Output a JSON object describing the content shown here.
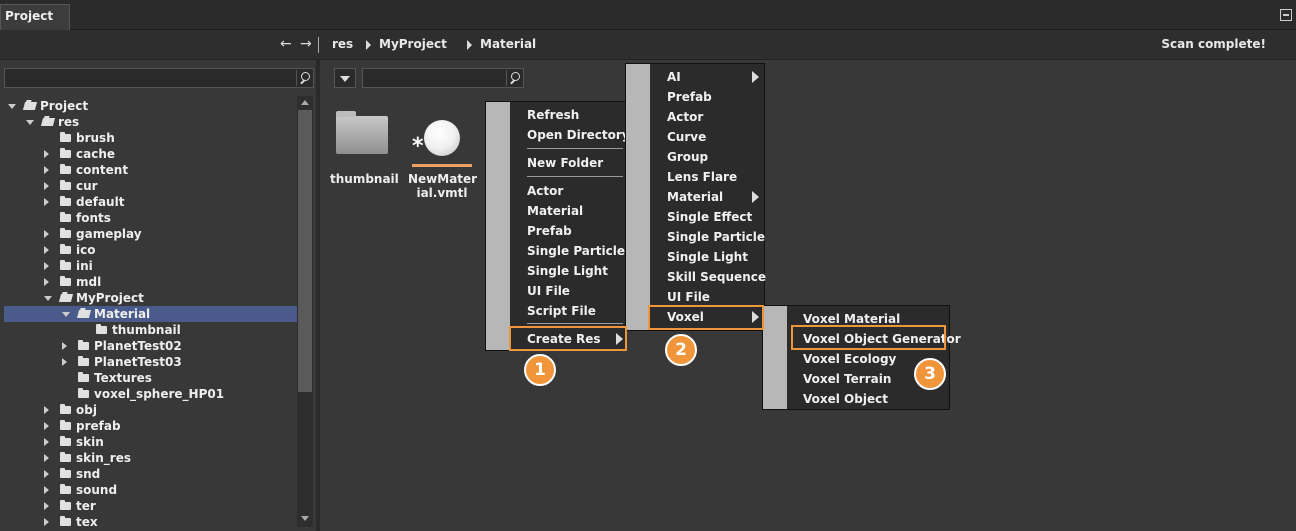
{
  "window": {
    "tab_title": "Project"
  },
  "nav": {
    "back_icon": "arrow-left-icon",
    "forward_icon": "arrow-right-icon",
    "breadcrumbs": [
      "res",
      "MyProject",
      "Material"
    ],
    "status": "Scan complete!"
  },
  "tree": {
    "items": [
      {
        "label": "Project",
        "depth": 0,
        "expanded": true
      },
      {
        "label": "res",
        "depth": 1,
        "expanded": true
      },
      {
        "label": "brush",
        "depth": 2
      },
      {
        "label": "cache",
        "depth": 2
      },
      {
        "label": "content",
        "depth": 2
      },
      {
        "label": "cur",
        "depth": 2
      },
      {
        "label": "default",
        "depth": 2
      },
      {
        "label": "fonts",
        "depth": 2
      },
      {
        "label": "gameplay",
        "depth": 2
      },
      {
        "label": "ico",
        "depth": 2
      },
      {
        "label": "ini",
        "depth": 2
      },
      {
        "label": "mdl",
        "depth": 2
      },
      {
        "label": "MyProject",
        "depth": 2,
        "expanded": true
      },
      {
        "label": "Material",
        "depth": 3,
        "expanded": true,
        "selected": true
      },
      {
        "label": "thumbnail",
        "depth": 4
      },
      {
        "label": "PlanetTest02",
        "depth": 3
      },
      {
        "label": "PlanetTest03",
        "depth": 3
      },
      {
        "label": "Textures",
        "depth": 3
      },
      {
        "label": "voxel_sphere_HP01",
        "depth": 3
      },
      {
        "label": "obj",
        "depth": 2
      },
      {
        "label": "prefab",
        "depth": 2
      },
      {
        "label": "skin",
        "depth": 2
      },
      {
        "label": "skin_res",
        "depth": 2
      },
      {
        "label": "snd",
        "depth": 2
      },
      {
        "label": "sound",
        "depth": 2
      },
      {
        "label": "ter",
        "depth": 2
      },
      {
        "label": "tex",
        "depth": 2
      }
    ]
  },
  "files": [
    {
      "name": "thumbnail",
      "icon": "folder-icon"
    },
    {
      "name_line1": "NewMater",
      "name_line2": "ial.vmtl",
      "icon": "material-sphere-icon"
    }
  ],
  "menu1": {
    "items": [
      "Refresh",
      "Open Directory",
      "New Folder",
      "Actor",
      "Material",
      "Prefab",
      "Single Particle",
      "Single Light",
      "UI File",
      "Script File",
      "Create Res"
    ]
  },
  "menu2": {
    "items": [
      "AI",
      "Prefab",
      "Actor",
      "Curve",
      "Group",
      "Lens Flare",
      "Material",
      "Single Effect",
      "Single Particle",
      "Single Light",
      "Skill Sequence",
      "UI File",
      "Voxel"
    ]
  },
  "menu3": {
    "items": [
      "Voxel Material",
      "Voxel Object Generator",
      "Voxel Ecology",
      "Voxel Terrain",
      "Voxel Object"
    ]
  },
  "steps": [
    "1",
    "2",
    "3"
  ],
  "colors": {
    "accent": "#f0953a",
    "selection": "#4a5a8a"
  }
}
